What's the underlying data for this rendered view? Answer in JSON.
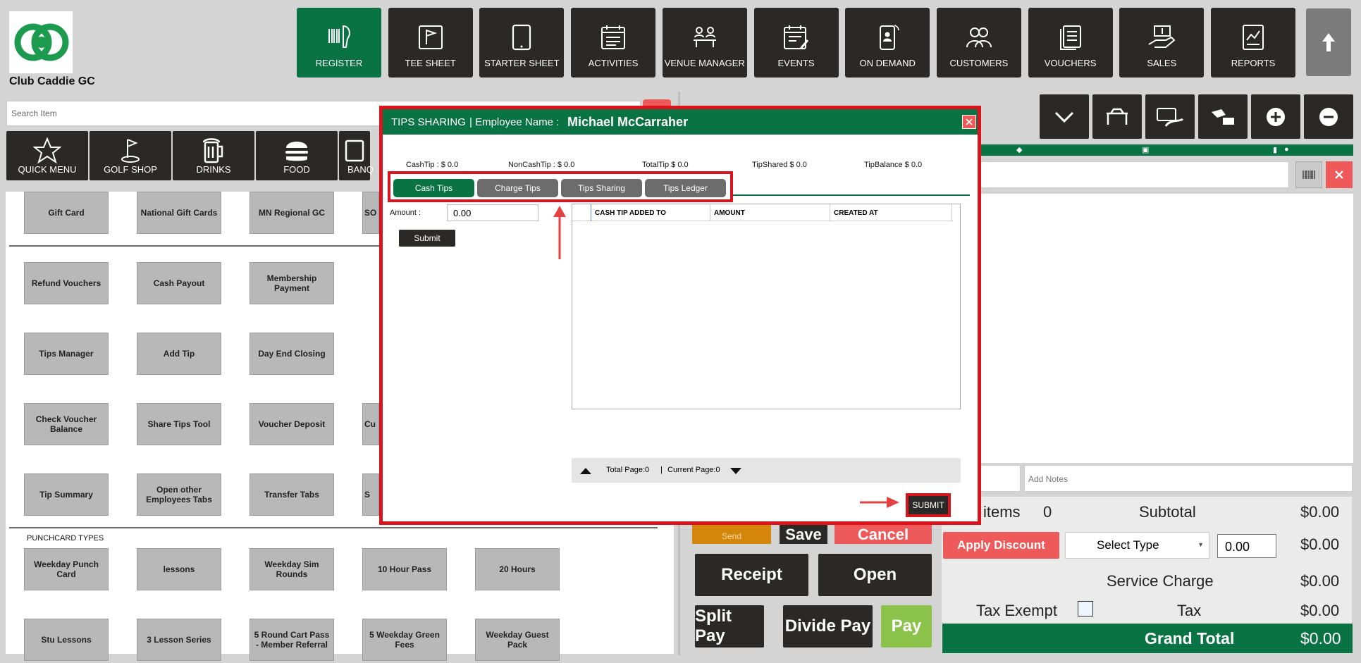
{
  "app": {
    "name": "Club Caddie GC"
  },
  "nav": [
    {
      "label": "REGISTER",
      "icon": "barcode-scanner-icon",
      "active": true
    },
    {
      "label": "TEE SHEET",
      "icon": "flag-icon"
    },
    {
      "label": "STARTER SHEET",
      "icon": "tablet-icon"
    },
    {
      "label": "ACTIVITIES",
      "icon": "calendar-list-icon"
    },
    {
      "label": "VENUE MANAGER",
      "icon": "meeting-table-icon"
    },
    {
      "label": "EVENTS",
      "icon": "calendar-edit-icon"
    },
    {
      "label": "ON DEMAND",
      "icon": "mobile-user-icon"
    },
    {
      "label": "CUSTOMERS",
      "icon": "users-icon"
    },
    {
      "label": "VOUCHERS",
      "icon": "documents-icon"
    },
    {
      "label": "SALES",
      "icon": "money-hand-icon"
    },
    {
      "label": "REPORTS",
      "icon": "report-chart-icon"
    }
  ],
  "search": {
    "placeholder": "Search Item"
  },
  "categories": [
    {
      "label": "QUICK MENU",
      "icon": "star-icon"
    },
    {
      "label": "GOLF SHOP",
      "icon": "golf-icon"
    },
    {
      "label": "DRINKS",
      "icon": "beer-icon"
    },
    {
      "label": "FOOD",
      "icon": "burger-icon"
    },
    {
      "label": "BANQ",
      "icon": "banquet-icon"
    }
  ],
  "items": {
    "row1": [
      "Gift Card",
      "National Gift Cards",
      "MN Regional GC",
      "SO"
    ],
    "row2": [
      "Refund Vouchers",
      "Cash Payout",
      "Membership Payment"
    ],
    "row3": [
      "Tips Manager",
      "Add Tip",
      "Day End Closing"
    ],
    "row4": [
      "Check Voucher Balance",
      "Share Tips Tool",
      "Voucher Deposit",
      "Cu"
    ],
    "row5": [
      "Tip Summary",
      "Open other Employees Tabs",
      "Transfer Tabs",
      "S"
    ]
  },
  "punchcard": {
    "title": "PUNCHCARD TYPES",
    "row1": [
      "Weekday Punch Card",
      "lessons",
      "Weekday Sim Rounds",
      "10 Hour Pass",
      "20 Hours"
    ],
    "row2": [
      "Stu Lessons",
      "3 Lesson Series",
      "5 Round Cart Pass - Member Referral",
      "5 Weekday Green Fees",
      "Weekday Guest Pack"
    ]
  },
  "cart": {
    "notes_placeholder": "Add Notes",
    "items_label": "l items",
    "items_count": "0",
    "subtotal_label": "Subtotal",
    "subtotal": "$0.00",
    "apply_discount": "Apply Discount",
    "select_type": "Select Type",
    "discount_value": "0.00",
    "discount_total": "$0.00",
    "service_charge_label": "Service Charge",
    "service_charge": "$0.00",
    "tax_exempt_label": "Tax Exempt",
    "tax_label": "Tax",
    "tax": "$0.00",
    "grand_total_label": "Grand Total",
    "grand_total": "$0.00",
    "send": "Send",
    "save": "Save",
    "cancel": "Cancel",
    "receipt": "Receipt",
    "open": "Open",
    "split_pay": "Split Pay",
    "divide_pay": "Divide Pay",
    "pay": "Pay"
  },
  "modal": {
    "title": "TIPS SHARING",
    "employee_label": "| Employee Name :",
    "employee_name": "Michael McCarraher",
    "stats": {
      "cash_tip": "CashTip : $ 0.0",
      "non_cash_tip": "NonCashTip : $ 0.0",
      "total_tip": "TotalTip  $ 0.0",
      "tip_shared": "TipShared  $ 0.0",
      "tip_balance": "TipBalance  $ 0.0"
    },
    "tabs": [
      "Cash Tips",
      "Charge Tips",
      "Tips Sharing",
      "Tips Ledger"
    ],
    "amount_label": "Amount :",
    "amount_value": "0.00",
    "submit": "Submit",
    "columns": [
      "CASH TIP ADDED TO",
      "AMOUNT",
      "CREATED AT"
    ],
    "pager": {
      "total": "Total Page:0",
      "separator": "|",
      "current": "Current Page:0"
    },
    "submit_bottom": "SUBMIT"
  },
  "colors": {
    "brand_green": "#0a7343",
    "dark": "#2b2927",
    "highlight_red": "#d9141c",
    "pay_green": "#8bc34a",
    "danger": "#ee5a5a",
    "send_orange": "#d4860b"
  }
}
